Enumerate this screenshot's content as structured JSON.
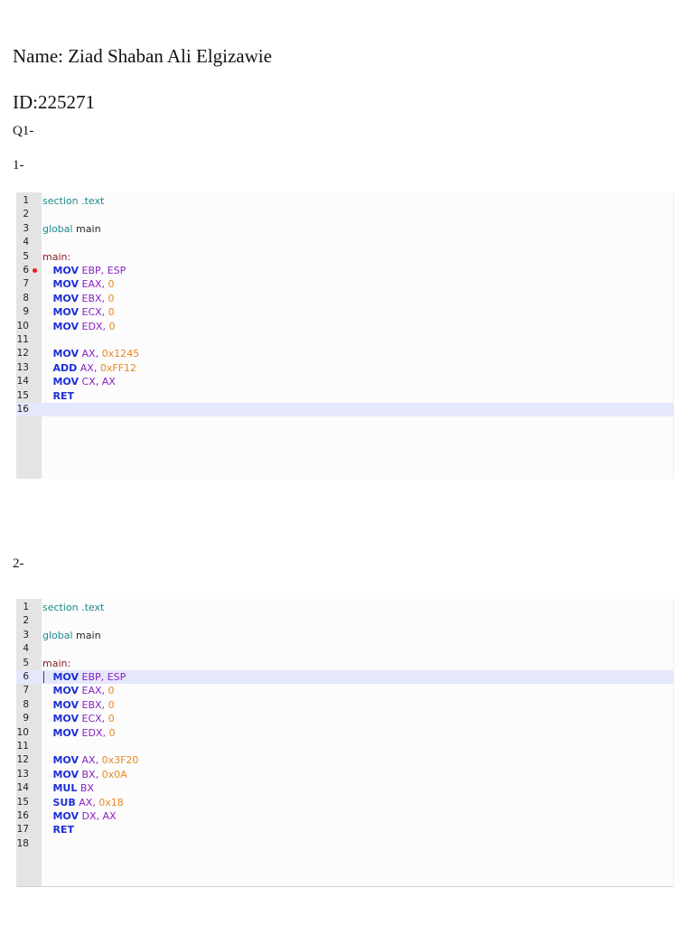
{
  "header": {
    "name": "Name: Ziad Shaban Ali Elgizawie",
    "id": "ID:225271",
    "question": "Q1-"
  },
  "parts": [
    {
      "label": "1-",
      "highlight_line": 16,
      "breakpoint_line": 6,
      "lines": [
        {
          "n": "1",
          "tokens": [
            {
              "t": "section .text",
              "c": "teal"
            }
          ]
        },
        {
          "n": "2",
          "tokens": []
        },
        {
          "n": "3",
          "tokens": [
            {
              "t": "global",
              "c": "teal"
            },
            {
              "t": " main",
              "c": "black"
            }
          ]
        },
        {
          "n": "4",
          "tokens": []
        },
        {
          "n": "5",
          "tokens": [
            {
              "t": "main:",
              "c": "maroon"
            }
          ]
        },
        {
          "n": "6",
          "tokens": [
            {
              "t": "   MOV",
              "c": "blue"
            },
            {
              "t": " EBP, ESP",
              "c": "purple"
            }
          ]
        },
        {
          "n": "7",
          "tokens": [
            {
              "t": "   MOV",
              "c": "blue"
            },
            {
              "t": " EAX, ",
              "c": "purple"
            },
            {
              "t": "0",
              "c": "orange"
            }
          ]
        },
        {
          "n": "8",
          "tokens": [
            {
              "t": "   MOV",
              "c": "blue"
            },
            {
              "t": " EBX, ",
              "c": "purple"
            },
            {
              "t": "0",
              "c": "orange"
            }
          ]
        },
        {
          "n": "9",
          "tokens": [
            {
              "t": "   MOV",
              "c": "blue"
            },
            {
              "t": " ECX, ",
              "c": "purple"
            },
            {
              "t": "0",
              "c": "orange"
            }
          ]
        },
        {
          "n": "10",
          "tokens": [
            {
              "t": "   MOV",
              "c": "blue"
            },
            {
              "t": " EDX, ",
              "c": "purple"
            },
            {
              "t": "0",
              "c": "orange"
            }
          ]
        },
        {
          "n": "11",
          "tokens": []
        },
        {
          "n": "12",
          "tokens": [
            {
              "t": "   MOV",
              "c": "blue"
            },
            {
              "t": " AX, ",
              "c": "purple"
            },
            {
              "t": "0x1245",
              "c": "orange"
            }
          ]
        },
        {
          "n": "13",
          "tokens": [
            {
              "t": "   ADD",
              "c": "blue"
            },
            {
              "t": " AX, ",
              "c": "purple"
            },
            {
              "t": "0xFF12",
              "c": "orange"
            }
          ]
        },
        {
          "n": "14",
          "tokens": [
            {
              "t": "   MOV",
              "c": "blue"
            },
            {
              "t": " CX, AX",
              "c": "purple"
            }
          ]
        },
        {
          "n": "15",
          "tokens": [
            {
              "t": "   RET",
              "c": "blue"
            }
          ]
        },
        {
          "n": "16",
          "tokens": []
        }
      ]
    },
    {
      "label": "2-",
      "highlight_line": 6,
      "cursor_line": 6,
      "lines": [
        {
          "n": "1",
          "tokens": [
            {
              "t": "section .text",
              "c": "teal"
            }
          ]
        },
        {
          "n": "2",
          "tokens": []
        },
        {
          "n": "3",
          "tokens": [
            {
              "t": "global",
              "c": "teal"
            },
            {
              "t": " main",
              "c": "black"
            }
          ]
        },
        {
          "n": "4",
          "tokens": []
        },
        {
          "n": "5",
          "tokens": [
            {
              "t": "main:",
              "c": "maroon"
            }
          ]
        },
        {
          "n": "6",
          "tokens": [
            {
              "t": "   MOV",
              "c": "blue"
            },
            {
              "t": " EBP, ESP",
              "c": "purple"
            }
          ]
        },
        {
          "n": "7",
          "tokens": [
            {
              "t": "   MOV",
              "c": "blue"
            },
            {
              "t": " EAX, ",
              "c": "purple"
            },
            {
              "t": "0",
              "c": "orange"
            }
          ]
        },
        {
          "n": "8",
          "tokens": [
            {
              "t": "   MOV",
              "c": "blue"
            },
            {
              "t": " EBX, ",
              "c": "purple"
            },
            {
              "t": "0",
              "c": "orange"
            }
          ]
        },
        {
          "n": "9",
          "tokens": [
            {
              "t": "   MOV",
              "c": "blue"
            },
            {
              "t": " ECX, ",
              "c": "purple"
            },
            {
              "t": "0",
              "c": "orange"
            }
          ]
        },
        {
          "n": "10",
          "tokens": [
            {
              "t": "   MOV",
              "c": "blue"
            },
            {
              "t": " EDX, ",
              "c": "purple"
            },
            {
              "t": "0",
              "c": "orange"
            }
          ]
        },
        {
          "n": "11",
          "tokens": []
        },
        {
          "n": "12",
          "tokens": [
            {
              "t": "   MOV",
              "c": "blue"
            },
            {
              "t": " AX, ",
              "c": "purple"
            },
            {
              "t": "0x3F20",
              "c": "orange"
            }
          ]
        },
        {
          "n": "13",
          "tokens": [
            {
              "t": "   MOV",
              "c": "blue"
            },
            {
              "t": " BX, ",
              "c": "purple"
            },
            {
              "t": "0x0A",
              "c": "orange"
            }
          ]
        },
        {
          "n": "14",
          "tokens": [
            {
              "t": "   MUL",
              "c": "blue"
            },
            {
              "t": " BX",
              "c": "purple"
            }
          ]
        },
        {
          "n": "15",
          "tokens": [
            {
              "t": "   SUB",
              "c": "blue"
            },
            {
              "t": " AX, ",
              "c": "purple"
            },
            {
              "t": "0x18",
              "c": "orange"
            }
          ]
        },
        {
          "n": "16",
          "tokens": [
            {
              "t": "   MOV",
              "c": "blue"
            },
            {
              "t": " DX, AX",
              "c": "purple"
            }
          ]
        },
        {
          "n": "17",
          "tokens": [
            {
              "t": "   RET",
              "c": "blue"
            }
          ]
        },
        {
          "n": "18",
          "tokens": []
        }
      ]
    }
  ],
  "colors": {
    "keyword": "#1d2fd6",
    "register": "#8a1fc4",
    "number": "#e8871e",
    "directive": "#1a8a8a",
    "label": "#8b1a1a",
    "highlight": "#e5e8fb",
    "gutter": "#e4e4e4",
    "breakpoint": "#e02020"
  }
}
